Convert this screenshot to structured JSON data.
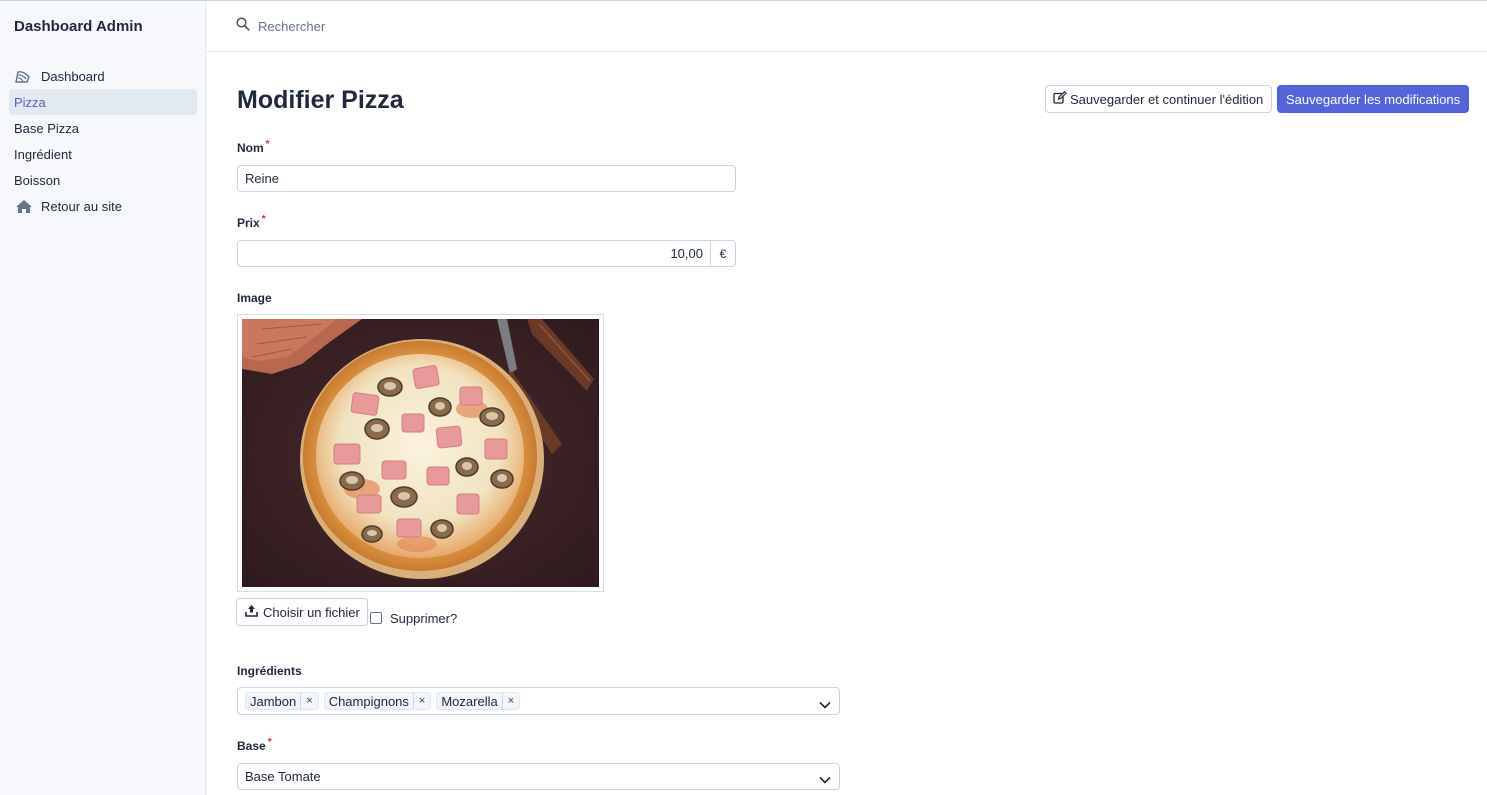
{
  "sidebar": {
    "brand": "Dashboard Admin",
    "items": [
      {
        "label": "Dashboard",
        "icon": "dashboard-icon",
        "active": false
      },
      {
        "label": "Pizza",
        "active": true
      },
      {
        "label": "Base Pizza",
        "active": false
      },
      {
        "label": "Ingrédient",
        "active": false
      },
      {
        "label": "Boisson",
        "active": false
      },
      {
        "label": "Retour au site",
        "icon": "home-icon",
        "active": false
      }
    ]
  },
  "topbar": {
    "search_placeholder": "Rechercher"
  },
  "header": {
    "title": "Modifier Pizza",
    "save_continue_label": "Sauvegarder et continuer l'édition",
    "save_label": "Sauvegarder les modifications"
  },
  "form": {
    "name": {
      "label": "Nom",
      "required": "*",
      "value": "Reine"
    },
    "price": {
      "label": "Prix",
      "required": "*",
      "value": "10,00",
      "currency": "€"
    },
    "image": {
      "label": "Image",
      "choose_file_label": "Choisir un fichier",
      "delete_label": "Supprimer?"
    },
    "ingredients": {
      "label": "Ingrédients",
      "selected": [
        "Jambon",
        "Champignons",
        "Mozarella"
      ],
      "remove_glyph": "×"
    },
    "base": {
      "label": "Base",
      "required": "*",
      "value": "Base Tomate"
    }
  },
  "colors": {
    "accent": "#5563dd",
    "sidebar_bg": "#f6f8fb",
    "active_bg": "#e3e9f1",
    "required": "#e11d48"
  }
}
